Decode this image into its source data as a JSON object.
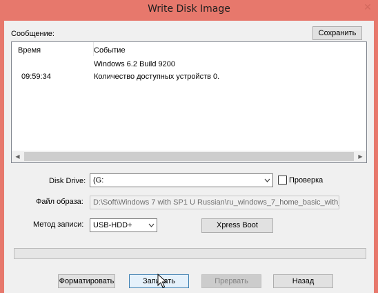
{
  "window": {
    "title": "Write Disk Image",
    "close_glyph": "✕"
  },
  "message": {
    "label": "Сообщение:",
    "save_button": "Сохранить",
    "columns": [
      "Время",
      "Событие"
    ],
    "rows": [
      {
        "time": "",
        "event": "Windows 6.2 Build 9200"
      },
      {
        "time": "09:59:34",
        "event": "Количество доступных устройств 0."
      }
    ],
    "scroll_left": "◀",
    "scroll_right": "▶"
  },
  "disk": {
    "label": "Disk Drive:",
    "value": "(G:",
    "verify_label": "Проверка",
    "verify_checked": false
  },
  "image_file": {
    "label": "Файл образа:",
    "value": "D:\\Soft\\Windows 7 with SP1 U Russian\\ru_windows_7_home_basic_with_"
  },
  "write_method": {
    "label": "Метод записи:",
    "value": "USB-HDD+",
    "xpress_boot": "Xpress Boot"
  },
  "progress": {
    "percent": 0
  },
  "buttons": {
    "format": "Форматировать",
    "write": "Записать",
    "abort": "Прервать",
    "back": "Назад"
  },
  "icons": {
    "dropdown": "chevron-down-icon",
    "close": "close-icon",
    "cursor": "mouse-pointer-icon"
  }
}
